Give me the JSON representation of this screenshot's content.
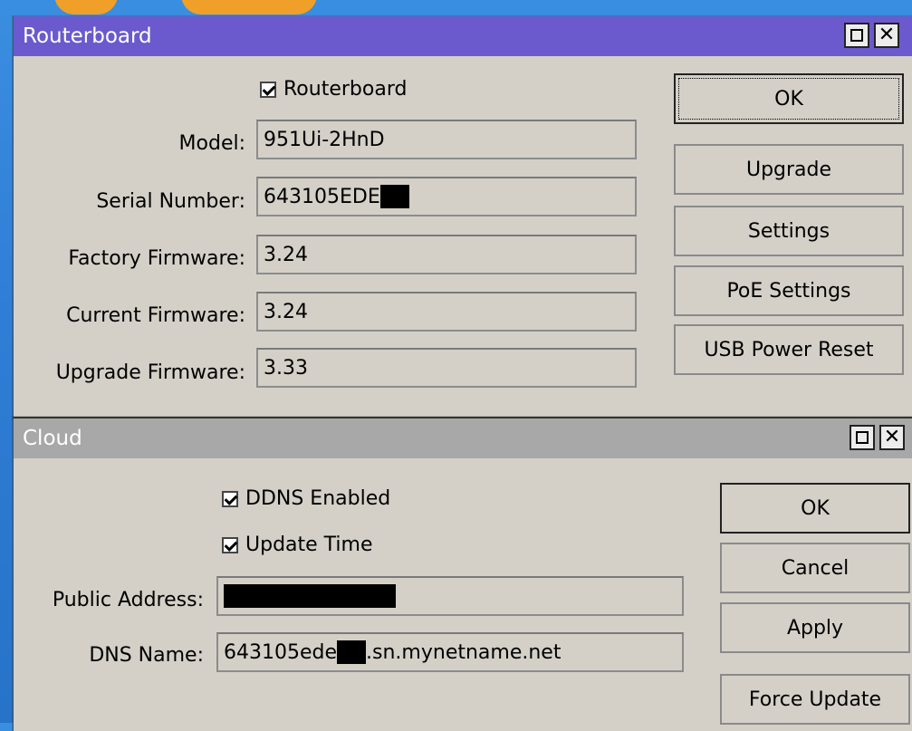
{
  "routerboard": {
    "title": "Routerboard",
    "checkbox_label": "Routerboard",
    "fields": [
      {
        "label": "Model:",
        "value": "951Ui-2HnD"
      },
      {
        "label": "Serial Number:",
        "value": "643105EDE"
      },
      {
        "label": "Factory Firmware:",
        "value": "3.24"
      },
      {
        "label": "Current Firmware:",
        "value": "3.24"
      },
      {
        "label": "Upgrade Firmware:",
        "value": "3.33"
      }
    ],
    "buttons": {
      "ok": "OK",
      "upgrade": "Upgrade",
      "settings": "Settings",
      "poe_settings": "PoE Settings",
      "usb_power_reset": "USB Power Reset"
    }
  },
  "cloud": {
    "title": "Cloud",
    "ddns_enabled_label": "DDNS Enabled",
    "update_time_label": "Update Time",
    "public_address_label": "Public Address:",
    "dns_name_label": "DNS Name:",
    "dns_name_prefix": "643105ede",
    "dns_name_suffix": ".sn.mynetname.net",
    "buttons": {
      "ok": "OK",
      "cancel": "Cancel",
      "apply": "Apply",
      "force_update": "Force Update"
    }
  },
  "colors": {
    "routerboard_titlebar": "#6a5acd",
    "cloud_titlebar": "#a8a8a8",
    "window_bg": "#d4d0c8",
    "desktop": "#2f7fd6"
  },
  "icons": {
    "maximize": "maximize-icon",
    "close": "close-icon"
  }
}
